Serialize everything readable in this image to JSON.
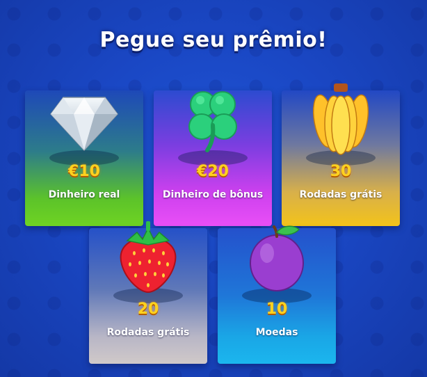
{
  "title": "Pegue seu prêmio!",
  "prizes": [
    {
      "icon": "diamond-icon",
      "amount": "€10",
      "label": "Dinheiro real"
    },
    {
      "icon": "clover-icon",
      "amount": "€20",
      "label": "Dinheiro de bônus"
    },
    {
      "icon": "banana-icon",
      "amount": "30",
      "label": "Rodadas grátis"
    },
    {
      "icon": "strawberry-icon",
      "amount": "20",
      "label": "Rodadas grátis"
    },
    {
      "icon": "plum-icon",
      "amount": "10",
      "label": "Moedas"
    }
  ],
  "colors": {
    "background": "#1a47c4",
    "amount_text": "#ffd21f",
    "card_green": "#6fd323",
    "card_purple": "#e94ff7",
    "card_yellow": "#f3c31a",
    "card_grey": "#d0c9c9",
    "card_cyan": "#1bb6ee"
  }
}
